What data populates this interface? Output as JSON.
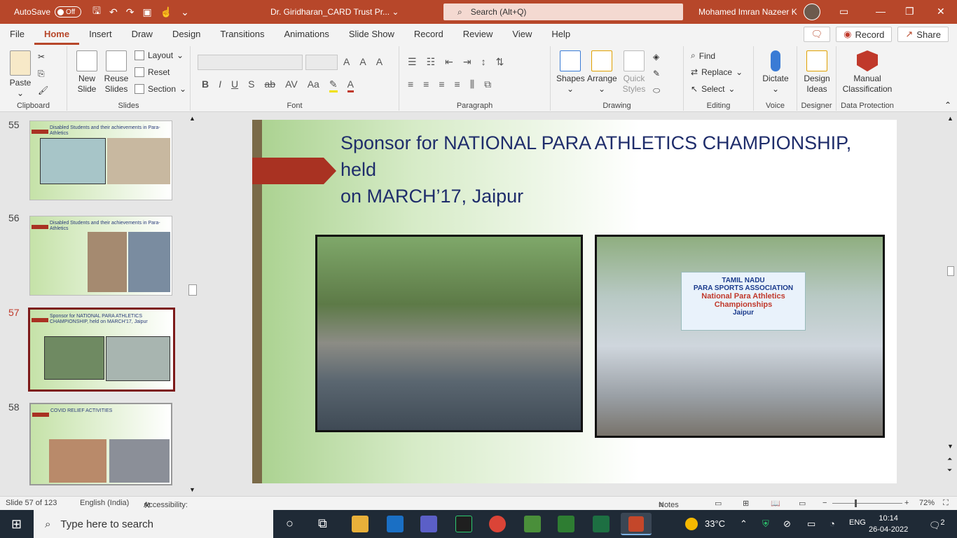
{
  "titlebar": {
    "autosave_label": "AutoSave",
    "autosave_state": "Off",
    "doc_title": "Dr. Giridharan_CARD Trust Pr...",
    "search_placeholder": "Search (Alt+Q)",
    "user_name": "Mohamed Imran Nazeer K"
  },
  "menu": {
    "tabs": [
      "File",
      "Home",
      "Insert",
      "Draw",
      "Design",
      "Transitions",
      "Animations",
      "Slide Show",
      "Record",
      "Review",
      "View",
      "Help"
    ],
    "record_button": "Record",
    "share_button": "Share"
  },
  "ribbon": {
    "clipboard": {
      "label": "Clipboard",
      "paste": "Paste"
    },
    "slides": {
      "label": "Slides",
      "new_slide": "New",
      "new_slide2": "Slide",
      "reuse": "Reuse",
      "reuse2": "Slides",
      "layout": "Layout",
      "reset": "Reset",
      "section": "Section"
    },
    "font": {
      "label": "Font"
    },
    "paragraph": {
      "label": "Paragraph"
    },
    "drawing": {
      "label": "Drawing",
      "shapes": "Shapes",
      "arrange": "Arrange",
      "quick_styles": "Quick",
      "quick_styles2": "Styles"
    },
    "editing": {
      "label": "Editing",
      "find": "Find",
      "replace": "Replace",
      "select": "Select"
    },
    "voice": {
      "label": "Voice",
      "dictate": "Dictate"
    },
    "designer": {
      "label": "Designer",
      "design_ideas": "Design",
      "design_ideas2": "Ideas"
    },
    "data_protection": {
      "label": "Data Protection",
      "manual": "Manual",
      "manual2": "Classification"
    }
  },
  "thumbnails": [
    {
      "num": "55",
      "title": "Disabled Students and their achievements in Para-Athletics"
    },
    {
      "num": "56",
      "title": "Disabled Students and their achievements in Para-Athletics"
    },
    {
      "num": "57",
      "title": "Sponsor for NATIONAL PARA ATHLETICS CHAMPIONSHIP, held on MARCH'17, Jaipur"
    },
    {
      "num": "58",
      "title": "COVID RELIEF ACTIVITIES"
    }
  ],
  "slide": {
    "title_line1": "Sponsor for NATIONAL PARA ATHLETICS CHAMPIONSHIP, held",
    "title_line2": "on MARCH’17, Jaipur",
    "banner_line1": "TAMIL NADU",
    "banner_line2": "PARA SPORTS ASSOCIATION",
    "banner_line3": "National Para Athletics",
    "banner_line4": "Championships",
    "banner_line5": "Jaipur"
  },
  "statusbar": {
    "slide_info": "Slide 57 of 123",
    "language": "English (India)",
    "accessibility": "Accessibility: Investigate",
    "notes": "Notes",
    "zoom": "72%"
  },
  "taskbar": {
    "search_placeholder": "Type here to search",
    "temperature": "33°C",
    "lang": "ENG",
    "time": "10:14",
    "date": "26-04-2022",
    "notifications": "2"
  },
  "colors": {
    "accent": "#b7472a",
    "title_blue": "#1f2d6b",
    "taskbar": "#1f2a36"
  }
}
